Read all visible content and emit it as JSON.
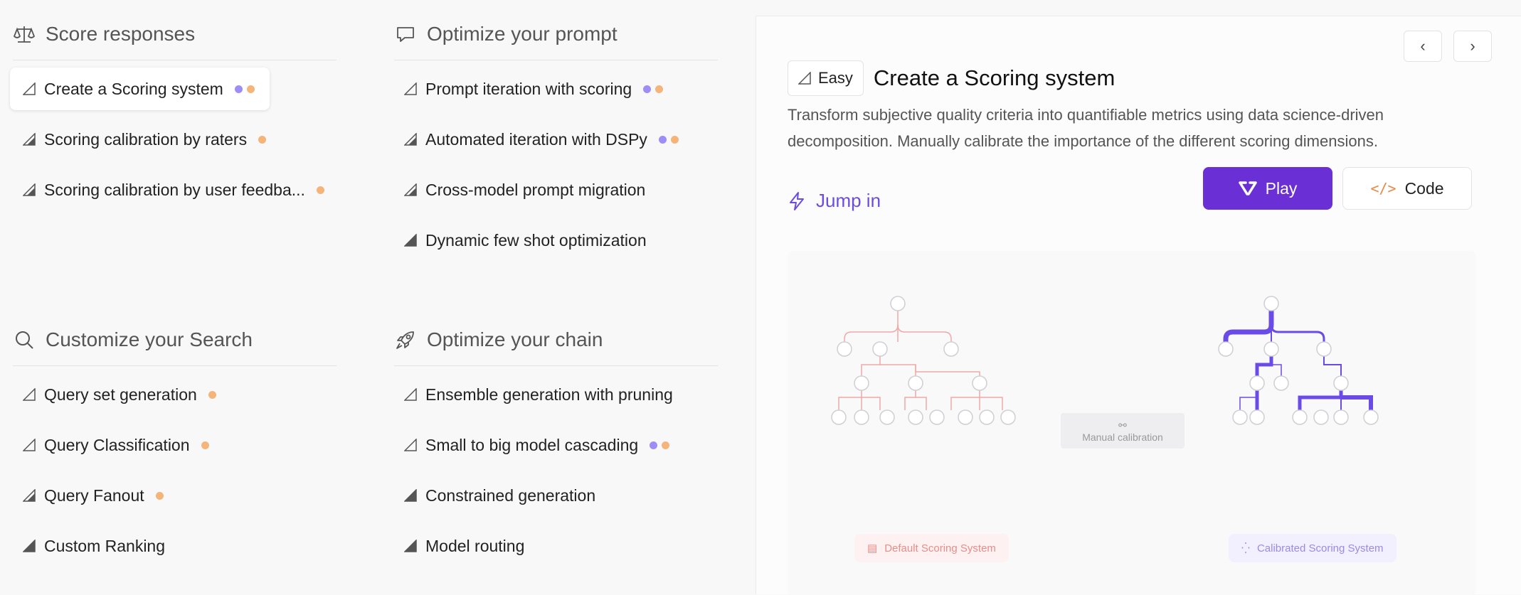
{
  "sections": [
    {
      "key": "score",
      "title": "Score responses",
      "icon": "scale-icon",
      "items": [
        {
          "label": "Create a Scoring system",
          "difficulty": "easy",
          "dots": [
            "purple",
            "orange"
          ],
          "active": true
        },
        {
          "label": "Scoring calibration by raters",
          "difficulty": "medium",
          "dots": [
            "orange"
          ]
        },
        {
          "label": "Scoring calibration by user feedba...",
          "difficulty": "medium",
          "dots": [
            "orange"
          ]
        }
      ]
    },
    {
      "key": "prompt",
      "title": "Optimize your prompt",
      "icon": "chat-bubble-icon",
      "items": [
        {
          "label": "Prompt iteration with scoring",
          "difficulty": "easy",
          "dots": [
            "purple",
            "orange"
          ]
        },
        {
          "label": "Automated iteration with DSPy",
          "difficulty": "medium",
          "dots": [
            "purple",
            "orange"
          ]
        },
        {
          "label": "Cross-model prompt migration",
          "difficulty": "medium",
          "dots": []
        },
        {
          "label": "Dynamic few shot optimization",
          "difficulty": "hard",
          "dots": []
        }
      ]
    },
    {
      "key": "search",
      "title": "Customize your Search",
      "icon": "search-icon",
      "items": [
        {
          "label": "Query set generation",
          "difficulty": "easy",
          "dots": [
            "orange"
          ]
        },
        {
          "label": "Query Classification",
          "difficulty": "easy",
          "dots": [
            "orange"
          ]
        },
        {
          "label": "Query Fanout",
          "difficulty": "medium",
          "dots": [
            "orange"
          ]
        },
        {
          "label": "Custom Ranking",
          "difficulty": "hard",
          "dots": []
        }
      ]
    },
    {
      "key": "chain",
      "title": "Optimize your chain",
      "icon": "rocket-icon",
      "items": [
        {
          "label": "Ensemble generation with pruning",
          "difficulty": "easy",
          "dots": []
        },
        {
          "label": "Small to big model cascading",
          "difficulty": "easy",
          "dots": [
            "purple",
            "orange"
          ]
        },
        {
          "label": "Constrained generation",
          "difficulty": "hard",
          "dots": []
        },
        {
          "label": "Model routing",
          "difficulty": "hard",
          "dots": []
        }
      ]
    }
  ],
  "detail": {
    "difficulty_label": "Easy",
    "title": "Create a Scoring system",
    "description": "Transform subjective quality criteria into quantifiable metrics using data science-driven decomposition. Manually calibrate the importance of the different scoring dimensions.",
    "jump_in_label": "Jump in",
    "play_label": "Play",
    "code_label": "Code",
    "prev_icon": "chevron-left-icon",
    "next_icon": "chevron-right-icon",
    "illustration": {
      "calibration_label": "Manual calibration",
      "default_label": "Default Scoring System",
      "calibrated_label": "Calibrated Scoring System"
    }
  },
  "colors": {
    "accent": "#6a30d6",
    "dot_purple": "#9d8df6",
    "dot_orange": "#f5b47a",
    "tree_red": "#f0a8a8",
    "tree_purple": "#6a4be8"
  }
}
